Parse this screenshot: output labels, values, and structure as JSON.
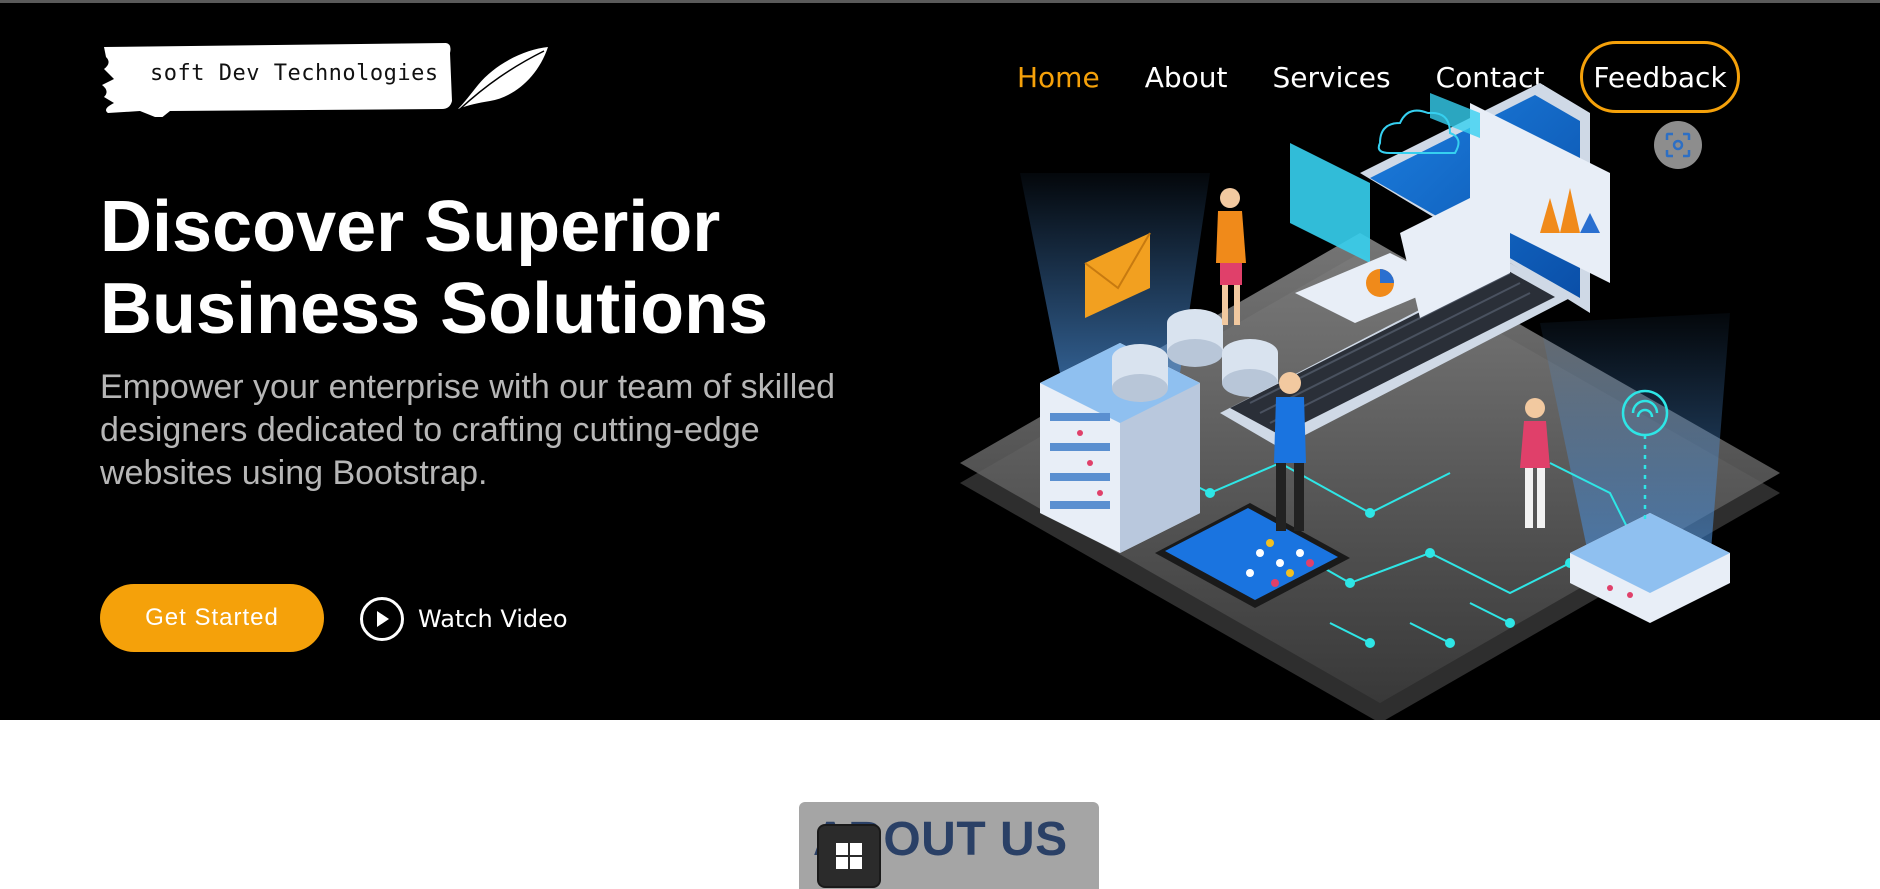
{
  "brand": {
    "name": "soft Dev Technologies",
    "logo_icon": "feather-icon"
  },
  "nav": {
    "items": [
      {
        "label": "Home",
        "active": true
      },
      {
        "label": "About",
        "active": false
      },
      {
        "label": "Services",
        "active": false
      },
      {
        "label": "Contact",
        "active": false
      }
    ],
    "feedback_label": "Feedback"
  },
  "hero": {
    "title": "Discover Superior Business Solutions",
    "subtitle": "Empower your enterprise with our team of skilled designers dedicated to crafting cutting-edge websites using Bootstrap.",
    "primary_cta": "Get Started",
    "secondary_cta": "Watch Video"
  },
  "about": {
    "title": "ABOUT US"
  },
  "colors": {
    "accent": "#f5a10a",
    "hero_bg": "#000000",
    "about_title": "#2a4066",
    "subtitle": "#b6b6b6"
  },
  "icons": {
    "screenshot": "screen-capture-icon",
    "play": "play-icon",
    "windows": "windows-logo-icon"
  }
}
